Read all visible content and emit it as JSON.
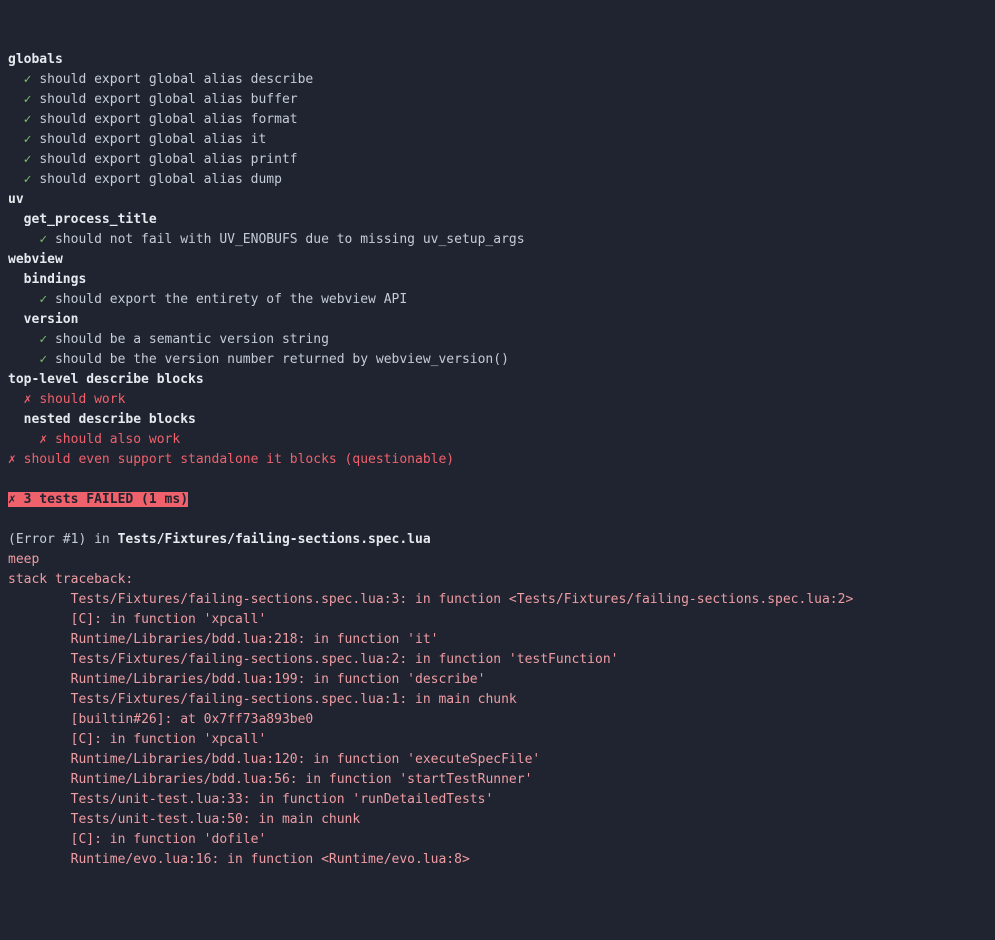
{
  "marks": {
    "pass": "✓",
    "fail": "✗"
  },
  "suites": [
    {
      "name": "globals",
      "tests": [
        "should export global alias describe",
        "should export global alias buffer",
        "should export global alias format",
        "should export global alias it",
        "should export global alias printf",
        "should export global alias dump"
      ]
    },
    {
      "name": "uv",
      "subs": [
        {
          "name": "get_process_title",
          "tests": [
            "should not fail with UV_ENOBUFS due to missing uv_setup_args"
          ]
        }
      ]
    },
    {
      "name": "webview",
      "subs": [
        {
          "name": "bindings",
          "tests": [
            "should export the entirety of the webview API"
          ]
        },
        {
          "name": "version",
          "tests": [
            "should be a semantic version string",
            "should be the version number returned by webview_version()"
          ]
        }
      ]
    }
  ],
  "failsuite": {
    "name": "top-level describe blocks",
    "fail": "should work",
    "sub": {
      "name": "nested describe blocks",
      "fail": "should also work"
    }
  },
  "standalone_fail": "should even support standalone it blocks (questionable)",
  "summary": "3 tests FAILED (1 ms)",
  "error": {
    "prefix": "(Error #1) in ",
    "file": "Tests/Fixtures/failing-sections.spec.lua",
    "msg": "meep",
    "trace_header": "stack traceback:",
    "trace": [
      "Tests/Fixtures/failing-sections.spec.lua:3: in function <Tests/Fixtures/failing-sections.spec.lua:2>",
      "[C]: in function 'xpcall'",
      "Runtime/Libraries/bdd.lua:218: in function 'it'",
      "Tests/Fixtures/failing-sections.spec.lua:2: in function 'testFunction'",
      "Runtime/Libraries/bdd.lua:199: in function 'describe'",
      "Tests/Fixtures/failing-sections.spec.lua:1: in main chunk",
      "[builtin#26]: at 0x7ff73a893be0",
      "[C]: in function 'xpcall'",
      "Runtime/Libraries/bdd.lua:120: in function 'executeSpecFile'",
      "Runtime/Libraries/bdd.lua:56: in function 'startTestRunner'",
      "Tests/unit-test.lua:33: in function 'runDetailedTests'",
      "Tests/unit-test.lua:50: in main chunk",
      "[C]: in function 'dofile'",
      "Runtime/evo.lua:16: in function <Runtime/evo.lua:8>"
    ]
  }
}
